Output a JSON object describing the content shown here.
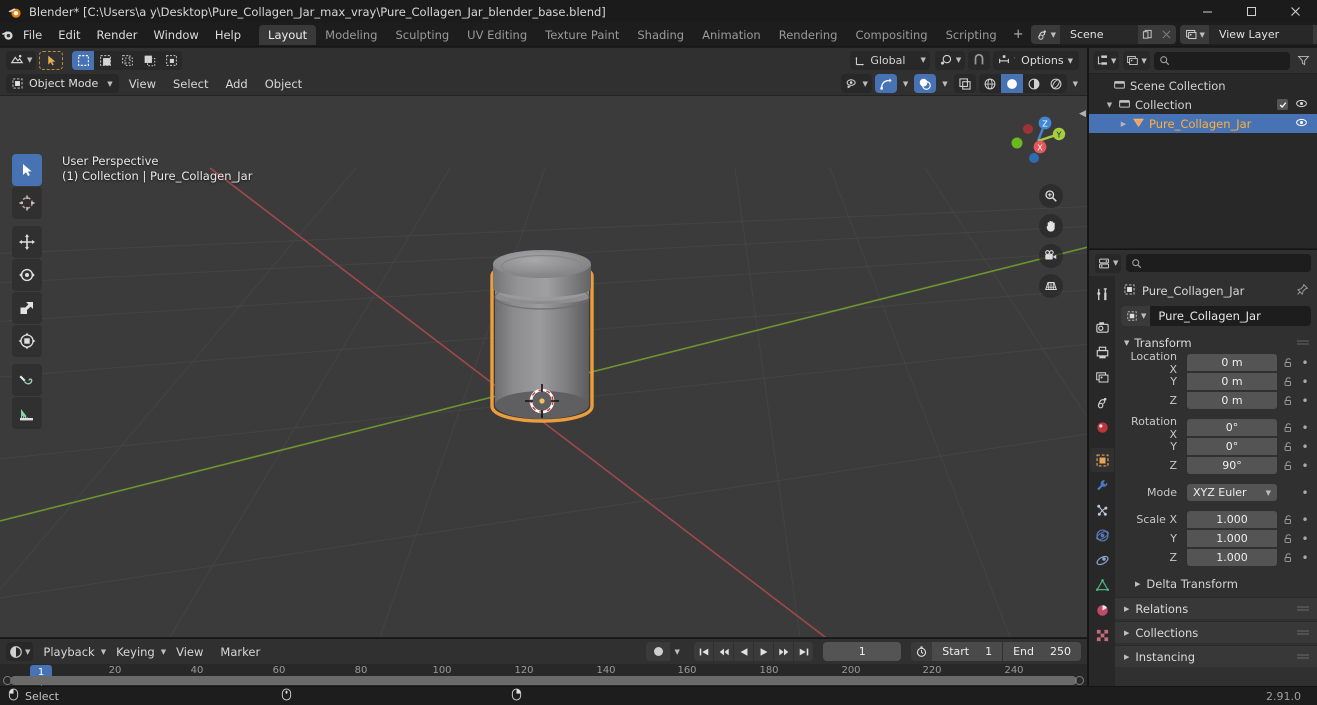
{
  "window": {
    "title": "Blender* [C:\\Users\\a y\\Desktop\\Pure_Collagen_Jar_max_vray\\Pure_Collagen_Jar_blender_base.blend]",
    "minimize_label": "minimize-icon",
    "maximize_label": "maximize-icon",
    "close_label": "close-icon"
  },
  "topbar": {
    "menus": [
      "File",
      "Edit",
      "Render",
      "Window",
      "Help"
    ],
    "workspaces": [
      {
        "label": "Layout",
        "active": true
      },
      {
        "label": "Modeling",
        "active": false
      },
      {
        "label": "Sculpting",
        "active": false
      },
      {
        "label": "UV Editing",
        "active": false
      },
      {
        "label": "Texture Paint",
        "active": false
      },
      {
        "label": "Shading",
        "active": false
      },
      {
        "label": "Animation",
        "active": false
      },
      {
        "label": "Rendering",
        "active": false
      },
      {
        "label": "Compositing",
        "active": false
      },
      {
        "label": "Scripting",
        "active": false
      }
    ],
    "add_workspace": "+",
    "scene": {
      "name": "Scene",
      "new_label": "new-scene-icon",
      "remove_label": "unlink-scene-icon"
    },
    "view_layer": {
      "name": "View Layer",
      "new_label": "new-viewlayer-icon",
      "remove_label": "remove-viewlayer-icon"
    }
  },
  "viewport": {
    "mode": "Object Mode",
    "menus": [
      "View",
      "Select",
      "Add",
      "Object"
    ],
    "transform_orientation": "Global",
    "options_label": "Options",
    "overlay_text_line1": "User Perspective",
    "overlay_text_line2": "(1) Collection | Pure_Collagen_Jar",
    "tools": [
      {
        "name": "tweak-select-box-tool",
        "active": true
      },
      {
        "name": "cursor-tool",
        "active": false
      },
      {
        "name": "move-tool",
        "active": false
      },
      {
        "name": "rotate-tool",
        "active": false
      },
      {
        "name": "scale-tool",
        "active": false
      },
      {
        "name": "transform-tool",
        "active": false
      },
      {
        "name": "annotate-tool",
        "active": false
      },
      {
        "name": "measure-tool",
        "active": false
      }
    ],
    "gizmo_axes": [
      {
        "label": "X",
        "color": "#e2585b"
      },
      {
        "label": "Y",
        "color": "#a5cf3f"
      },
      {
        "label": "Z",
        "color": "#4287d6"
      }
    ],
    "nav_buttons": [
      "zoom-icon",
      "pan-hand-icon",
      "camera-view-icon",
      "toggle-orthographic-icon"
    ],
    "shading_modes": [
      {
        "name": "wireframe-shading",
        "active": false
      },
      {
        "name": "solid-shading",
        "active": true
      },
      {
        "name": "material-preview-shading",
        "active": false
      },
      {
        "name": "rendered-shading",
        "active": false
      }
    ],
    "object_color": "#8a8a8c",
    "selection_outline_color": "#ed9e3c",
    "background_color": "#3b3b3b",
    "grid_axis_x_color": "#a6494d",
    "grid_axis_y_color": "#6f9a2e"
  },
  "outliner": {
    "display_mode": "view-layer-icon",
    "filter_icon": "filter-icon",
    "search_placeholder": "",
    "rows": [
      {
        "label": "Scene Collection",
        "indent": 0,
        "icon": "collection-icon",
        "selected": false,
        "has_disclosure": false,
        "has_checkbox": false,
        "has_eye": false
      },
      {
        "label": "Collection",
        "indent": 1,
        "icon": "collection-icon",
        "selected": false,
        "has_disclosure": true,
        "has_checkbox": true,
        "has_eye": true
      },
      {
        "label": "Pure_Collagen_Jar",
        "indent": 2,
        "icon": "mesh-object-icon",
        "selected": true,
        "has_disclosure": true,
        "has_checkbox": false,
        "has_eye": true
      }
    ]
  },
  "properties": {
    "search_placeholder": "",
    "tabs": [
      {
        "name": "tool-properties-tab",
        "active": false
      },
      {
        "name": "render-properties-tab",
        "active": false
      },
      {
        "name": "output-properties-tab",
        "active": false
      },
      {
        "name": "view-layer-properties-tab",
        "active": false
      },
      {
        "name": "scene-properties-tab",
        "active": false
      },
      {
        "name": "world-properties-tab",
        "active": false
      },
      {
        "name": "object-properties-tab",
        "active": true
      },
      {
        "name": "modifier-properties-tab",
        "active": false
      },
      {
        "name": "particle-properties-tab",
        "active": false
      },
      {
        "name": "physics-properties-tab",
        "active": false
      },
      {
        "name": "constraint-properties-tab",
        "active": false
      },
      {
        "name": "object-data-properties-tab",
        "active": false
      },
      {
        "name": "material-properties-tab",
        "active": false
      },
      {
        "name": "texture-properties-tab",
        "active": false
      }
    ],
    "breadcrumb": "Pure_Collagen_Jar",
    "object_name": "Pure_Collagen_Jar",
    "transform": {
      "title": "Transform",
      "location": {
        "label_x": "Location X",
        "label_y": "Y",
        "label_z": "Z",
        "x": "0 m",
        "y": "0 m",
        "z": "0 m"
      },
      "rotation": {
        "label_x": "Rotation X",
        "label_y": "Y",
        "label_z": "Z",
        "x": "0°",
        "y": "0°",
        "z": "90°"
      },
      "mode": {
        "label": "Mode",
        "value": "XYZ Euler"
      },
      "scale": {
        "label_x": "Scale X",
        "label_y": "Y",
        "label_z": "Z",
        "x": "1.000",
        "y": "1.000",
        "z": "1.000"
      },
      "delta_transform": "Delta Transform"
    },
    "closed_panels": [
      "Relations",
      "Collections",
      "Instancing"
    ]
  },
  "timeline": {
    "editor_icon": "timeline-editor-icon",
    "menus": [
      "Playback",
      "Keying",
      "View",
      "Marker"
    ],
    "auto_keying": "record-icon",
    "transport": [
      "jump-to-start-icon",
      "jump-to-prev-keyframe-icon",
      "play-reverse-icon",
      "play-icon",
      "jump-to-next-keyframe-icon",
      "jump-to-end-icon"
    ],
    "current_frame": "1",
    "start_label": "Start",
    "start_value": "1",
    "end_label": "End",
    "end_value": "250",
    "ticks": [
      "20",
      "40",
      "60",
      "80",
      "100",
      "120",
      "140",
      "160",
      "180",
      "200",
      "220",
      "240"
    ],
    "playhead_label": "1"
  },
  "statusbar": {
    "mouse_left_action": "Select",
    "version": "2.91.0"
  }
}
